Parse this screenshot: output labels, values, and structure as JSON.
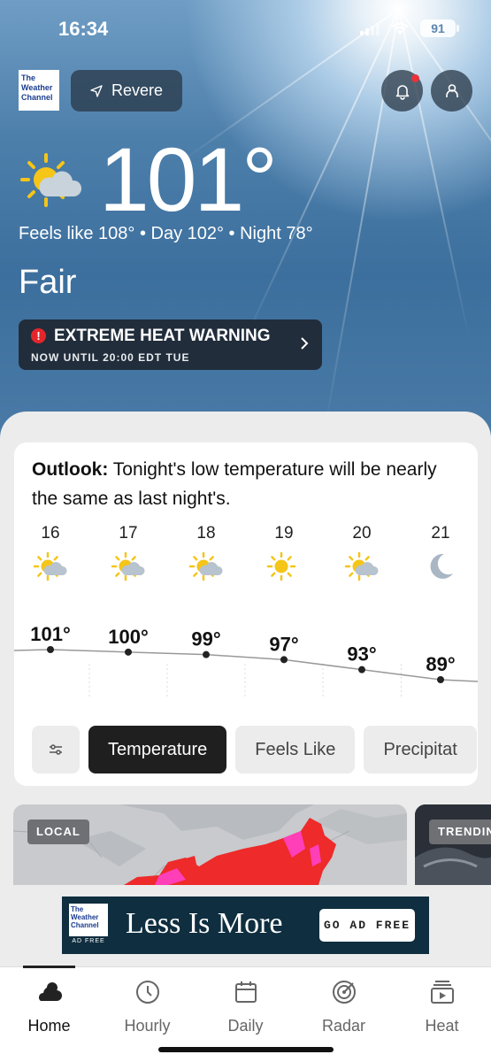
{
  "status_bar": {
    "time": "16:34",
    "battery": "91"
  },
  "header": {
    "logo_lines": [
      "The",
      "Weather",
      "Channel"
    ],
    "location": "Revere"
  },
  "current": {
    "temperature": "101°",
    "feels_line": "Feels like 108° • Day 102° • Night 78°",
    "phrase": "Fair",
    "icon": "sun-cloud-icon"
  },
  "alert": {
    "title": "EXTREME HEAT WARNING",
    "subtitle": "NOW UNTIL 20:00 EDT TUE",
    "icon": "exclamation-icon"
  },
  "outlook": {
    "label": "Outlook:",
    "text": " Tonight's low temperature will be nearly the same as last night's."
  },
  "forecast": {
    "days": [
      {
        "date": "16",
        "icon": "sun-cloud-icon",
        "temp": "101°",
        "value": 101
      },
      {
        "date": "17",
        "icon": "sun-cloud-icon",
        "temp": "100°",
        "value": 100
      },
      {
        "date": "18",
        "icon": "sun-cloud-icon",
        "temp": "99°",
        "value": 99
      },
      {
        "date": "19",
        "icon": "sun-icon",
        "temp": "97°",
        "value": 97
      },
      {
        "date": "20",
        "icon": "sun-cloud-icon",
        "temp": "93°",
        "value": 93
      },
      {
        "date": "21",
        "icon": "moon-icon",
        "temp": "89°",
        "value": 89
      }
    ]
  },
  "chips": {
    "filter_icon": "sliders-icon",
    "items": [
      "Temperature",
      "Feels Like",
      "Precipitat"
    ],
    "active": "Temperature"
  },
  "map_cards": {
    "local": "LOCAL",
    "trending": "TRENDIN"
  },
  "ad": {
    "logo_lines": [
      "The",
      "Weather",
      "Channel"
    ],
    "logo_tag": "AD FREE",
    "headline": "Less Is More",
    "button": "GO AD FREE"
  },
  "tabs": [
    {
      "label": "Home",
      "icon": "cloud-icon",
      "active": true
    },
    {
      "label": "Hourly",
      "icon": "clock-icon",
      "active": false
    },
    {
      "label": "Daily",
      "icon": "calendar-icon",
      "active": false
    },
    {
      "label": "Radar",
      "icon": "radar-icon",
      "active": false
    },
    {
      "label": "Heat",
      "icon": "heat-video-icon",
      "active": false
    }
  ],
  "colors": {
    "accent_dark": "#1f1f1f",
    "alert_red": "#e3262b",
    "sun_yellow": "#f5c518",
    "map_red": "#ee2a2a",
    "map_magenta": "#ff3fb8"
  }
}
